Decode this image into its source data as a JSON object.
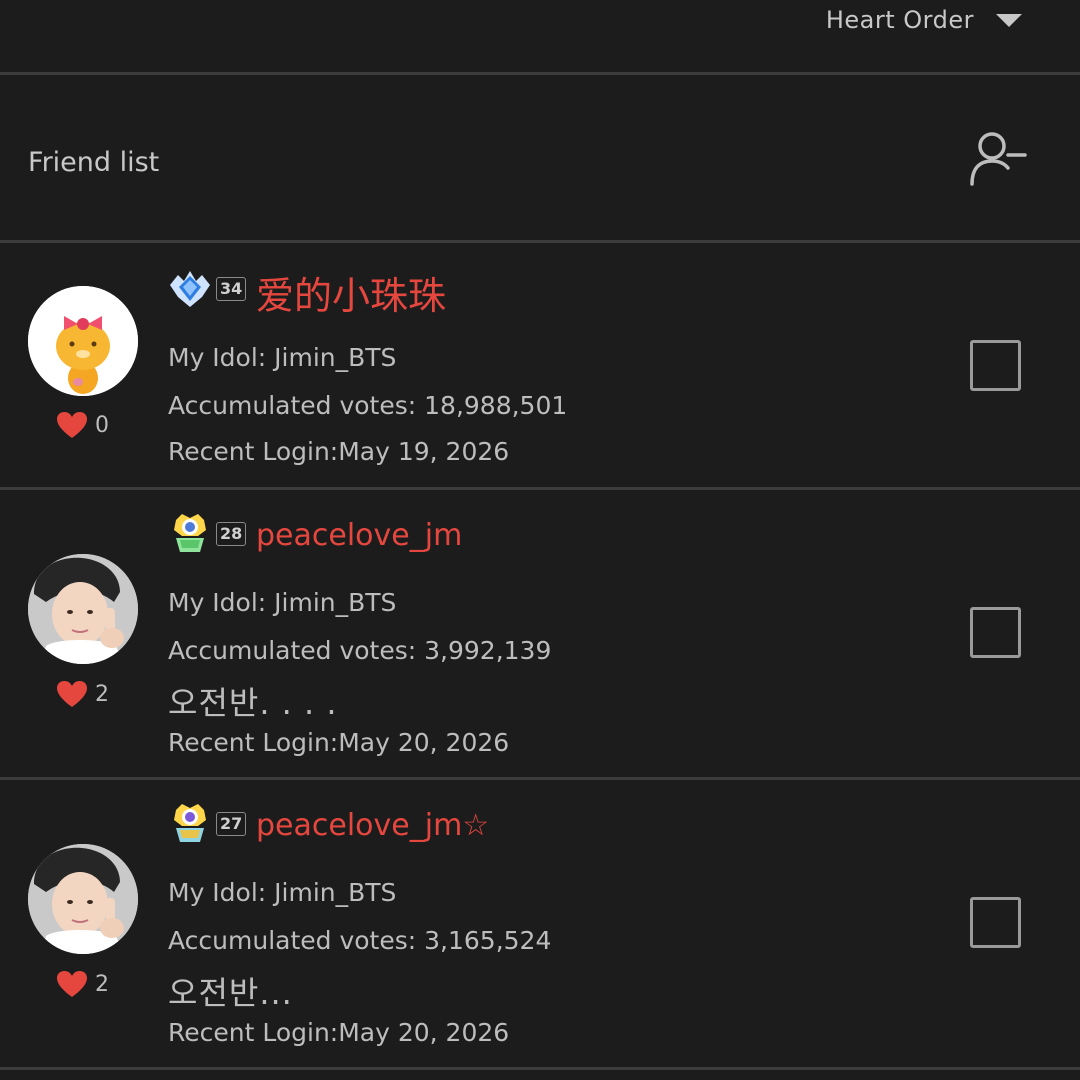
{
  "sort": {
    "label": "Heart Order"
  },
  "friends": {
    "title": "Friend list",
    "items": [
      {
        "name": "爱的小珠珠",
        "level": "34",
        "idol": "My Idol: Jimin_BTS",
        "votes": "Accumulated votes: 18,988,501",
        "status": "",
        "login": "Recent Login:May 19, 2026",
        "hearts": "0"
      },
      {
        "name": "peacelove_jm",
        "level": "28",
        "idol": "My Idol: Jimin_BTS",
        "votes": "Accumulated votes: 3,992,139",
        "status": "오전반. . . .",
        "login": "Recent Login:May 20, 2026",
        "hearts": "2"
      },
      {
        "name": "peacelove_jm☆",
        "level": "27",
        "idol": "My Idol: Jimin_BTS",
        "votes": "Accumulated votes: 3,165,524",
        "status": "오전반...",
        "login": "Recent Login:May 20, 2026",
        "hearts": "2"
      }
    ]
  },
  "colors": {
    "background": "#1c1c1c",
    "name": "#e5473f",
    "heart": "#e5473f",
    "text": "#bdbdbd"
  },
  "icons": {
    "remove_friend": "person-minus-icon",
    "sort": "caret-down-icon",
    "heart": "heart-icon"
  }
}
